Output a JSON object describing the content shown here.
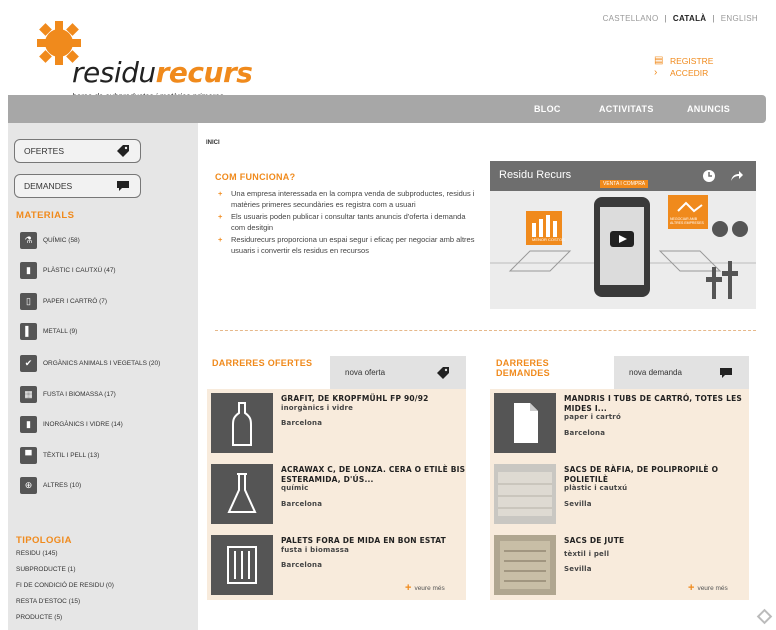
{
  "header": {
    "logo_part1": "residu",
    "logo_part2": "recurs",
    "tagline": "borsa de subproductes i matèries primeres",
    "languages": [
      "CASTELLANO",
      "CATALÀ",
      "ENGLISH"
    ],
    "active_language": "CATALÀ",
    "register": "REGISTRE",
    "login": "ACCEDIR"
  },
  "nav": {
    "items": [
      "BLOC",
      "ACTIVITATS",
      "ANUNCIS"
    ]
  },
  "sidebar": {
    "offers_button": "OFERTES",
    "demands_button": "DEMANDES",
    "materials_title": "MATERIALS",
    "materials": [
      {
        "label": "QUÍMIC (58)",
        "icon": "flask-icon"
      },
      {
        "label": "PLÀSTIC I CAUTXÚ (47)",
        "icon": "bottle-icon"
      },
      {
        "label": "PAPER I CARTRÓ (7)",
        "icon": "paper-icon"
      },
      {
        "label": "METALL (9)",
        "icon": "metal-icon"
      },
      {
        "label": "ORGÀNICS ANIMALS I VEGETALS (20)",
        "icon": "leaf-icon"
      },
      {
        "label": "FUSTA I BIOMASSA (17)",
        "icon": "wood-icon"
      },
      {
        "label": "INORGÀNICS I VIDRE (14)",
        "icon": "glass-icon"
      },
      {
        "label": "TÈXTIL I PELL (13)",
        "icon": "shirt-icon"
      },
      {
        "label": "ALTRES (10)",
        "icon": "plus-icon"
      }
    ],
    "typology_title": "TIPOLOGIA",
    "typology": [
      "RESIDU (145)",
      "SUBPRODUCTE (1)",
      "FI DE CONDICIÓ DE RESIDU (0)",
      "RESTA D'ESTOC (15)",
      "PRODUCTE (5)"
    ]
  },
  "main": {
    "breadcrumb": "INICI",
    "how_title": "COM FUNCIONA?",
    "how_items": [
      "Una empresa interessada en la compra venda de subproductes, residus i matèries primeres secundàries es registra com a usuari",
      "Els usuaris poden publicar i consultar tants anuncis d'oferta i demanda com desitgin",
      "Residurecurs proporciona un espai segur i eficaç per negociar amb altres usuaris i convertir els residus en recursos"
    ],
    "video": {
      "title": "Residu Recurs",
      "badge_left": "VENTA I COMPRA",
      "badge_mid": "MENOR COSTOS",
      "badge_right": "NEGOCIAR AMB ALTRES EMPRESES"
    },
    "offers": {
      "title_line1": "DARRERES OFERTES",
      "new_button": "nova oferta",
      "items": [
        {
          "title": "GRAFIT, DE KROPFMÜHL FP 90/92",
          "category": "inorgànics i vidre",
          "place": "Barcelona"
        },
        {
          "title": "ACRAWAX C, DE LONZA. CERA O ETILÈ BIS ESTERAMIDA, D'ÚS...",
          "category": "químic",
          "place": "Barcelona"
        },
        {
          "title": "PALETS FORA DE MIDA EN BON ESTAT",
          "category": "fusta i biomassa",
          "place": "Barcelona"
        }
      ],
      "more": "veure més"
    },
    "demands": {
      "title_line1": "DARRERES",
      "title_line2": "DEMANDES",
      "new_button": "nova demanda",
      "items": [
        {
          "title": "MANDRIS I TUBS DE CARTRÓ, TOTES LES MIDES I...",
          "category": "paper i cartró",
          "place": "Barcelona"
        },
        {
          "title": "SACS DE RÀFIA, DE POLIPROPILÈ O POLIETILÈ",
          "category": "plàstic i cautxú",
          "place": "Sevilla"
        },
        {
          "title": "SACS DE JUTE",
          "category": "tèxtil i pell",
          "place": "Sevilla"
        }
      ],
      "more": "veure més"
    }
  },
  "colors": {
    "accent": "#f08a1c",
    "nav": "#a7a7a7",
    "sidebar": "#e6e6e6",
    "panel": "#f8ebdc"
  }
}
